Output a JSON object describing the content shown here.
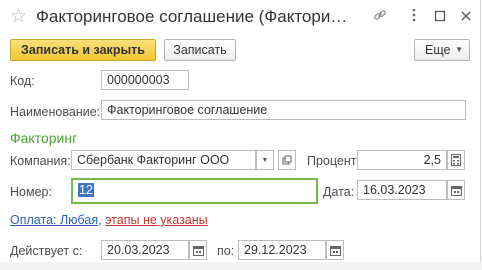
{
  "window": {
    "title": "Факторинговое соглашение (Факторинговое соглашение)"
  },
  "toolbar": {
    "save_close_label": "Записать и закрыть",
    "save_label": "Записать",
    "more_label": "Еще"
  },
  "form": {
    "code": {
      "label": "Код:",
      "value": "000000003"
    },
    "name": {
      "label": "Наименование:",
      "value": "Факторинговое соглашение"
    },
    "section_title": "Факторинг",
    "company": {
      "label": "Компания:",
      "value": "Сбербанк Факторинг ООО"
    },
    "percent": {
      "label": "Процент:",
      "value": "2,5"
    },
    "number": {
      "label": "Номер:",
      "value": "12"
    },
    "date": {
      "label": "Дата:",
      "value": "16.03.2023"
    },
    "payment_link": {
      "part1": "Оплата: Любая,",
      "part2": "этапы не указаны"
    },
    "valid_from": {
      "label": "Действует с:",
      "value": "20.03.2023"
    },
    "valid_to": {
      "label": "по:",
      "value": "29.12.2023"
    }
  },
  "colors": {
    "accent_button": "#f3c632",
    "section_title": "#4fa23a",
    "focus_border": "#76b94a",
    "link_blue": "#2b5fb5",
    "link_red": "#c0392b"
  },
  "icons": [
    "star-icon",
    "link-icon",
    "more-vertical-icon",
    "maximize-icon",
    "close-icon",
    "chevron-down-icon",
    "open-icon",
    "calculator-icon",
    "calendar-icon"
  ]
}
